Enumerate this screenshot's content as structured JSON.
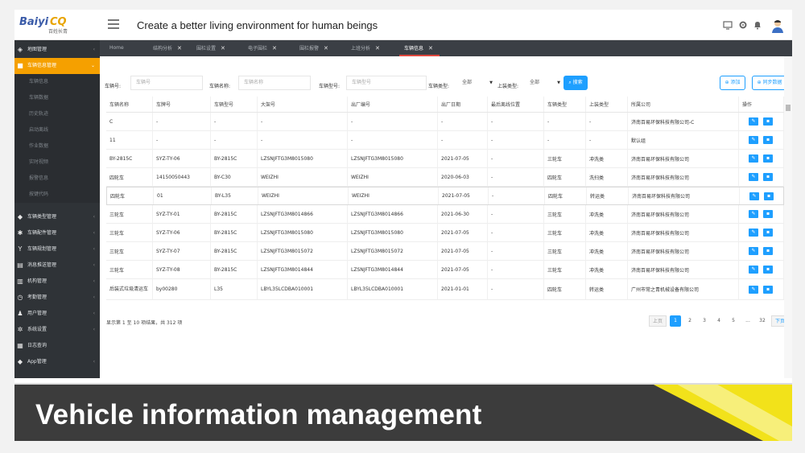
{
  "header": {
    "logo_text_a": "Baiyi",
    "logo_text_b": "CQ",
    "logo_sub": "百姓长青",
    "slogan": "Create a better living environment for human beings",
    "icons": [
      "monitor-icon",
      "gear-icon",
      "bell-icon",
      "user-avatar-icon"
    ]
  },
  "tabs": [
    {
      "label": "Home",
      "closable": false
    },
    {
      "label": "结构分析",
      "closable": true
    },
    {
      "label": "围栏设置",
      "closable": true
    },
    {
      "label": "电子围栏",
      "closable": true
    },
    {
      "label": "围栏报警",
      "closable": true
    },
    {
      "label": "上班分析",
      "closable": true
    },
    {
      "label": "车辆信息",
      "closable": true,
      "active": true
    }
  ],
  "sidebar": {
    "items": [
      {
        "label": "地图管理",
        "icon": "map-icon"
      },
      {
        "label": "车辆信息管理",
        "icon": "truck-icon",
        "open": true
      },
      {
        "label": "车辆类型管理",
        "icon": "cube-icon"
      },
      {
        "label": "车辆配件管理",
        "icon": "gear-icon"
      },
      {
        "label": "车辆规划管理",
        "icon": "route-icon"
      },
      {
        "label": "消息推送管理",
        "icon": "message-icon"
      },
      {
        "label": "机构管理",
        "icon": "bank-icon"
      },
      {
        "label": "考勤管理",
        "icon": "clock-icon"
      },
      {
        "label": "用户管理",
        "icon": "users-icon"
      },
      {
        "label": "系统设置",
        "icon": "settings-icon"
      },
      {
        "label": "日志查询",
        "icon": "log-icon"
      },
      {
        "label": "App管理",
        "icon": "app-icon"
      }
    ],
    "subitems": [
      "车辆信息",
      "车辆数据",
      "历史轨迹",
      "启动离线",
      "作业数据",
      "实时视频",
      "报警信息",
      "按键代码"
    ]
  },
  "filters": {
    "plate_label": "车辆号:",
    "plate_placeholder": "车辆号",
    "name_label": "车辆名称:",
    "name_placeholder": "车辆名称",
    "model_label": "车辆型号:",
    "model_placeholder": "车辆型号",
    "type_label": "车辆类型:",
    "type_value": "全部",
    "upload_label": "上装类型:",
    "upload_value": "全部",
    "search_label": "搜索",
    "add_label": "添加",
    "sync_label": "同步数据"
  },
  "table": {
    "columns": [
      "车辆名称",
      "车牌号",
      "车辆型号",
      "大架号",
      "出厂编号",
      "出厂日期",
      "最后离线位置",
      "车辆类型",
      "上装类型",
      "所属公司",
      "操作"
    ],
    "rows": [
      [
        "C",
        "-",
        "-",
        "-",
        "-",
        "-",
        "-",
        "-",
        "-",
        "济南百易环保科技有限公司-C"
      ],
      [
        "11",
        "-",
        "-",
        "-",
        "-",
        "-",
        "-",
        "-",
        "-",
        "默认组"
      ],
      [
        "BY-2815C",
        "SYZ-TY-06",
        "BY-2815C",
        "LZSNJFTG3M8015080",
        "LZSNJFTG3M8015080",
        "2021-07-05",
        "-",
        "三轮车",
        "冲洗类",
        "济南百易环保科技有限公司"
      ],
      [
        "四轮车",
        "14150050443",
        "BY-C30",
        "WEIZHI",
        "WEIZHI",
        "2020-06-03",
        "-",
        "四轮车",
        "洗扫类",
        "济南百易环保科技有限公司"
      ],
      [
        "四轮车",
        "01",
        "BY-L35",
        "WEIZHI",
        "WEIZHI",
        "2021-07-05",
        "-",
        "四轮车",
        "转运类",
        "济南百易环保科技有限公司"
      ],
      [
        "三轮车",
        "SYZ-TY-01",
        "BY-2815C",
        "LZSNJFTG3M8014866",
        "LZSNJFTG3M8014866",
        "2021-06-30",
        "-",
        "三轮车",
        "冲洗类",
        "济南百易环保科技有限公司"
      ],
      [
        "三轮车",
        "SYZ-TY-06",
        "BY-2815C",
        "LZSNJFTG3M8015080",
        "LZSNJFTG3M8015080",
        "2021-07-05",
        "-",
        "三轮车",
        "冲洗类",
        "济南百易环保科技有限公司"
      ],
      [
        "三轮车",
        "SYZ-TY-07",
        "BY-2815C",
        "LZSNJFTG3M8015072",
        "LZSNJFTG3M8015072",
        "2021-07-05",
        "-",
        "三轮车",
        "冲洗类",
        "济南百易环保科技有限公司"
      ],
      [
        "三轮车",
        "SYZ-TY-08",
        "BY-2815C",
        "LZSNJFTG3M8014844",
        "LZSNJFTG3M8014844",
        "2021-07-05",
        "-",
        "三轮车",
        "冲洗类",
        "济南百易环保科技有限公司"
      ],
      [
        "后装式垃圾清运车",
        "by00280",
        "L35",
        "LBYL35LCDBA010001",
        "LBYL35LCDBA010001",
        "2021-01-01",
        "-",
        "四轮车",
        "转运类",
        "广州市常之青机械设备有限公司"
      ]
    ]
  },
  "pagination": {
    "summary": "显示第 1 至 10 项结果，共 312 项",
    "prev": "上页",
    "pages": [
      "1",
      "2",
      "3",
      "4",
      "5"
    ],
    "ellipsis": "...",
    "last": "32",
    "next": "下页",
    "current": "1"
  },
  "banner": {
    "title": "Vehicle information management"
  },
  "colors": {
    "accent": "#1e9fff",
    "sidebar_active": "#f5a000",
    "sidebar_bg": "#2f3337",
    "banner_yellow": "#f2e21a",
    "banner_dark": "#3a3a3a"
  }
}
